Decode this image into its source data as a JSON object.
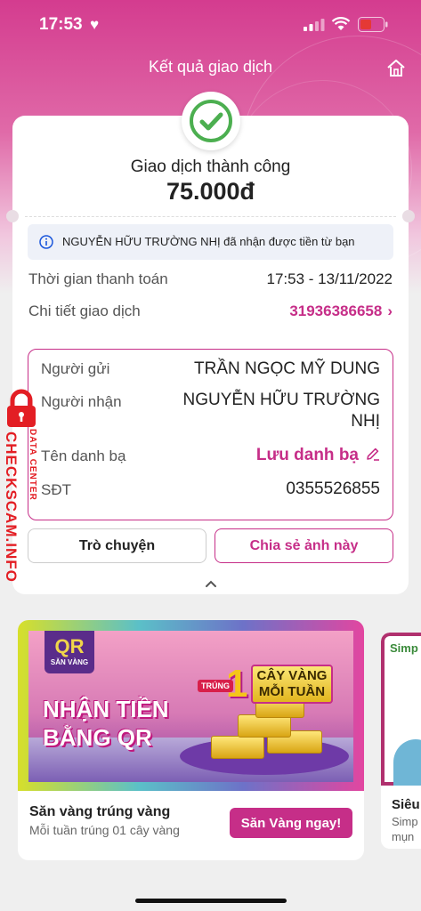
{
  "status_bar": {
    "time": "17:53"
  },
  "header": {
    "title": "Kết quả giao dịch"
  },
  "transaction": {
    "status": "Giao dịch thành công",
    "amount": "75.000đ",
    "info_message": "NGUYỄN HỮU TRƯỜNG NHỊ đã nhận được tiền từ bạn",
    "time_label": "Thời gian thanh toán",
    "time_value": "17:53 - 13/11/2022",
    "detail_label": "Chi tiết giao dịch",
    "detail_value": "31936386658"
  },
  "parties": {
    "sender_label": "Người gửi",
    "sender_value": "TRẦN NGỌC MỸ DUNG",
    "receiver_label": "Người nhận",
    "receiver_value": "NGUYỄN HỮU TRƯỜNG NHỊ",
    "contact_label": "Tên danh bạ",
    "contact_value": "Lưu danh bạ",
    "phone_label": "SĐT",
    "phone_value": "0355526855"
  },
  "actions": {
    "chat_label": "Trò chuyện",
    "share_label": "Chia sẻ ảnh này"
  },
  "watermark": {
    "brand": "CHECKSCAM.INFO",
    "sub": "DATA CENTER"
  },
  "promo": {
    "qr_badge": "QR",
    "qr_badge_sub": "SĂN VÀNG",
    "headline_line1": "NHẬN TIỀN",
    "headline_line2": "BẰNG QR",
    "badge_trung": "TRÚNG",
    "badge_number": "1",
    "badge_line1": "CÂY VÀNG",
    "badge_line2": "MỖI TUẦN",
    "title": "Săn vàng trúng vàng",
    "subtitle": "Mỗi tuần trúng 01 cây vàng",
    "cta": "Săn Vàng ngay!"
  },
  "promo2": {
    "brand": "Simp",
    "title": "Siêu",
    "line1": "Simp",
    "line2": "mụn"
  },
  "colors": {
    "accent": "#c62e88",
    "success": "#4caf50",
    "watermark": "#e31e24"
  }
}
